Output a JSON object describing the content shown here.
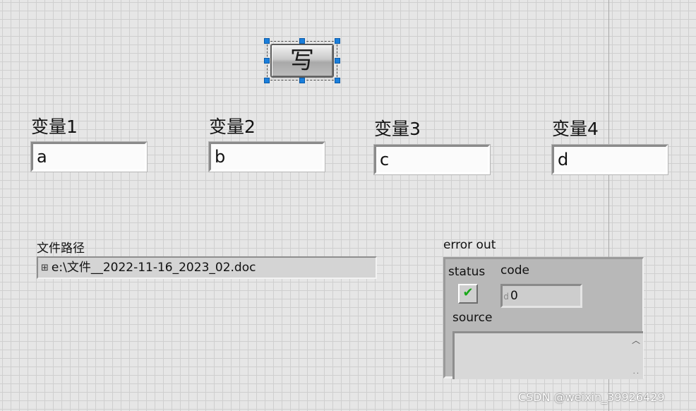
{
  "write_button": {
    "label": "写"
  },
  "variables": [
    {
      "label": "变量1",
      "value": "a"
    },
    {
      "label": "变量2",
      "value": "b"
    },
    {
      "label": "变量3",
      "value": "c"
    },
    {
      "label": "变量4",
      "value": "d"
    }
  ],
  "file_path": {
    "label": "文件路径",
    "value": "e:\\文件__2022-11-16_2023_02.doc"
  },
  "error_out": {
    "label": "error out",
    "status_label": "status",
    "status_mark": "✔",
    "code_label": "code",
    "code_radix": "d",
    "code_value": "0",
    "source_label": "source",
    "source_value": ""
  },
  "watermark": "CSDN @weixin_39926429"
}
